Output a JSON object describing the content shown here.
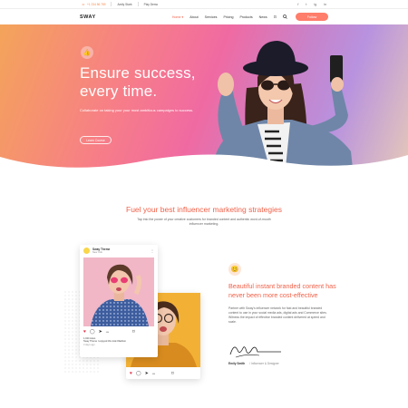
{
  "topbar": {
    "phone": "+1 234 56 789",
    "links": [
      "Amily Stark",
      "Play Demo"
    ],
    "socials": [
      "f",
      "t",
      "ig",
      "in"
    ]
  },
  "navbar": {
    "logo": "SWAY",
    "items": [
      "Home",
      "About",
      "Services",
      "Pricing",
      "Products",
      "News"
    ],
    "follow_label": "Follow"
  },
  "hero": {
    "title": "Ensure success, every time.",
    "subtitle": "Collaborate on taking your your most ambitious campaigns to success.",
    "button_label": "Learn Course"
  },
  "fuel": {
    "title": "Fuel your best influencer marketing strategies",
    "subtitle": "Tap into the power of your creative customers for branded content and authentic word-of-mouth influencer marketing."
  },
  "post1": {
    "name": "Sway Theme",
    "location": "New York",
    "likes": "1,024 Likes",
    "caption": "Sway Theme I enjoyed this look #fashion",
    "time": "3 days ago"
  },
  "content": {
    "title": "Beautiful instant branded content has never been more cost-effective",
    "text": "Partner with Sway's influencer network for fast and beautiful branded content to use in your social media ads, digital ads and Commerce sites. Witness the impact of effective branded content delivered at speed and scale.",
    "author_name": "Emily Smith",
    "author_role": "/ Influencer & Designer"
  },
  "colors": {
    "accent": "#f0624a",
    "follow_button": "#ff7d6b"
  }
}
